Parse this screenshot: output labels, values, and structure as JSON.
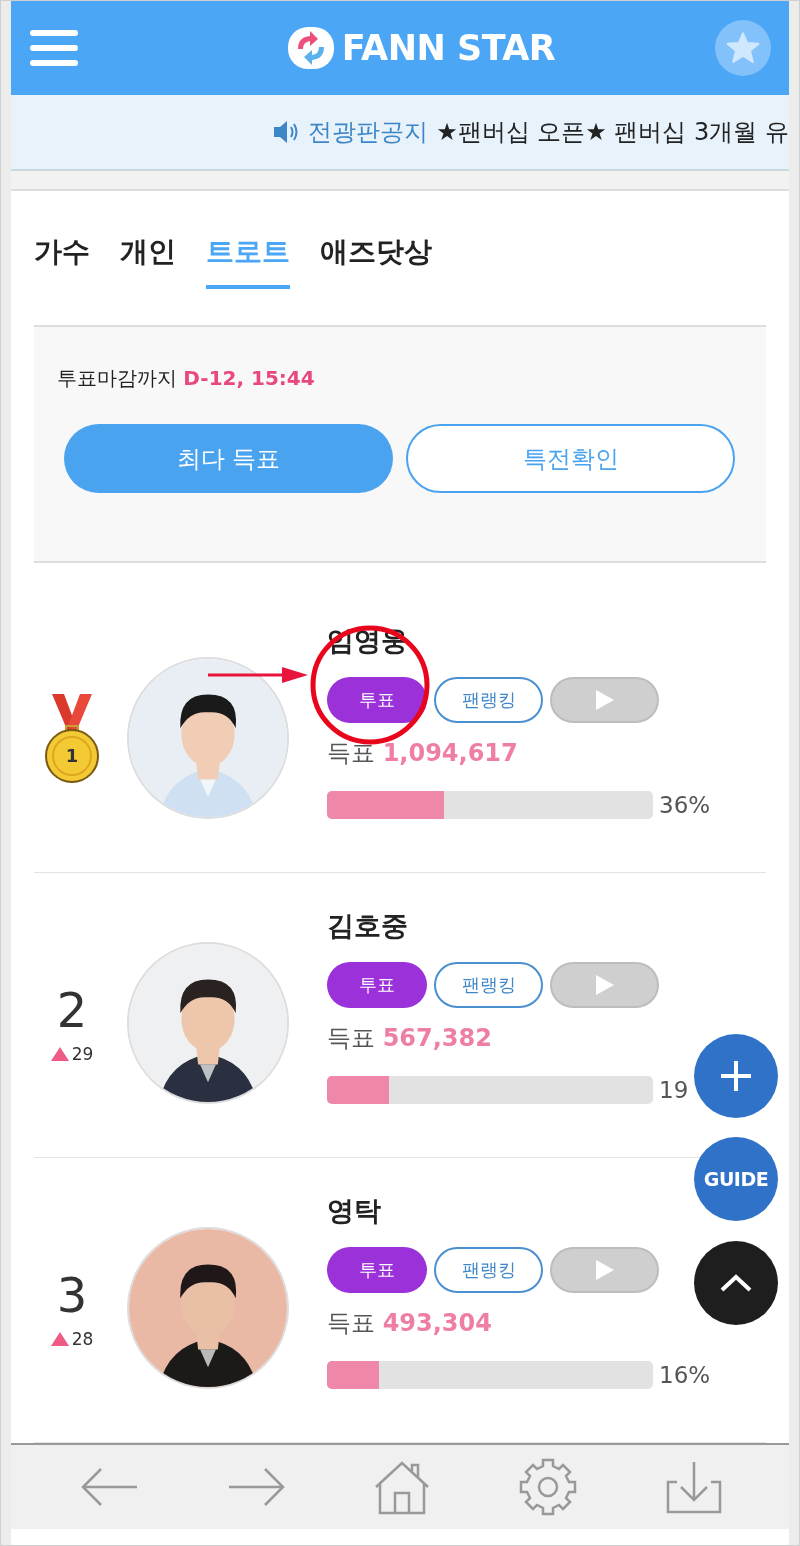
{
  "header": {
    "logo": "FANN STAR"
  },
  "notice": {
    "label": "전광판공지",
    "text": "★팬버십 오픈★ 팬버십 3개월 유"
  },
  "tabs": [
    {
      "label": "가수",
      "selected": false
    },
    {
      "label": "개인",
      "selected": false
    },
    {
      "label": "트로트",
      "selected": true
    },
    {
      "label": "애즈닷상",
      "selected": false
    }
  ],
  "deadline": {
    "label": "투표마감까지",
    "value": "D-12, 15:44"
  },
  "actions": [
    {
      "label": "최다 득표",
      "kind": "filled"
    },
    {
      "label": "특전확인",
      "kind": "outline"
    }
  ],
  "ranking": [
    {
      "kind": "medal",
      "rank": "1",
      "name": "임영웅",
      "vote_button": "투표",
      "fan_button": "팬랭킹",
      "votes_label": "득표",
      "votes": "1,094,617",
      "level": 0.36,
      "percent": "36%",
      "annotated": true
    },
    {
      "kind": "number",
      "rank": "2",
      "change": "29",
      "name": "김호중",
      "vote_button": "투표",
      "fan_button": "팬랭킹",
      "votes_label": "득표",
      "votes": "567,382",
      "level": 0.19,
      "percent": "19",
      "annotated": false
    },
    {
      "kind": "number",
      "rank": "3",
      "change": "28",
      "name": "영탁",
      "vote_button": "투표",
      "fan_button": "팬랭킹",
      "votes_label": "득표",
      "votes": "493,304",
      "level": 0.16,
      "percent": "16%",
      "annotated": false
    }
  ],
  "fab": {
    "guide": "GUIDE"
  }
}
